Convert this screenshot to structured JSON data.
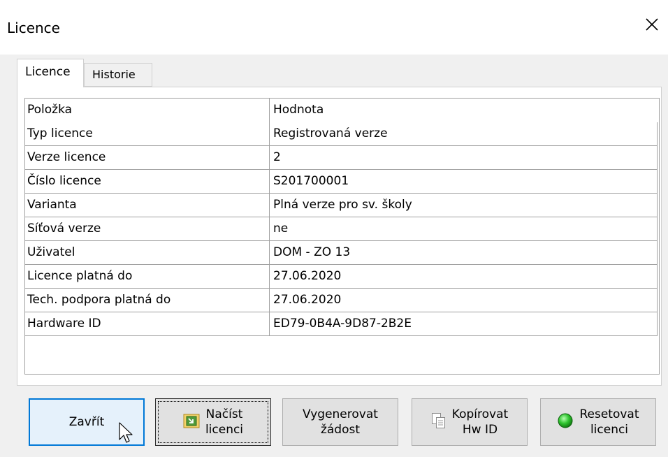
{
  "window": {
    "title": "Licence"
  },
  "tabs": [
    {
      "label": "Licence",
      "active": true
    },
    {
      "label": "Historie",
      "active": false
    }
  ],
  "grid": {
    "columns": [
      "Položka",
      "Hodnota"
    ],
    "rows": [
      [
        "Typ licence",
        "Registrovaná verze"
      ],
      [
        "Verze licence",
        "2"
      ],
      [
        "Číslo licence",
        "S201700001"
      ],
      [
        "Varianta",
        "Plná verze pro sv. školy"
      ],
      [
        "Síťová verze",
        "ne"
      ],
      [
        "Uživatel",
        "DOM - ZO 13"
      ],
      [
        "Licence platná do",
        "27.06.2020"
      ],
      [
        "Tech. podpora platná do",
        "27.06.2020"
      ],
      [
        "Hardware ID",
        "ED79-0B4A-9D87-2B2E"
      ]
    ]
  },
  "buttons": {
    "close": {
      "line1": "Zavřít",
      "line2": ""
    },
    "load": {
      "line1": "Načíst",
      "line2": "licenci",
      "icon": "import-icon"
    },
    "generate": {
      "line1": "Vygenerovat",
      "line2": "žádost"
    },
    "copy": {
      "line1": "Kopírovat",
      "line2": "Hw ID",
      "icon": "copy-icon"
    },
    "reset": {
      "line1": "Resetovat",
      "line2": "licenci",
      "icon": "green-light-icon"
    }
  },
  "colors": {
    "accent": "#0078d7",
    "status_green": "#2fc42f"
  }
}
